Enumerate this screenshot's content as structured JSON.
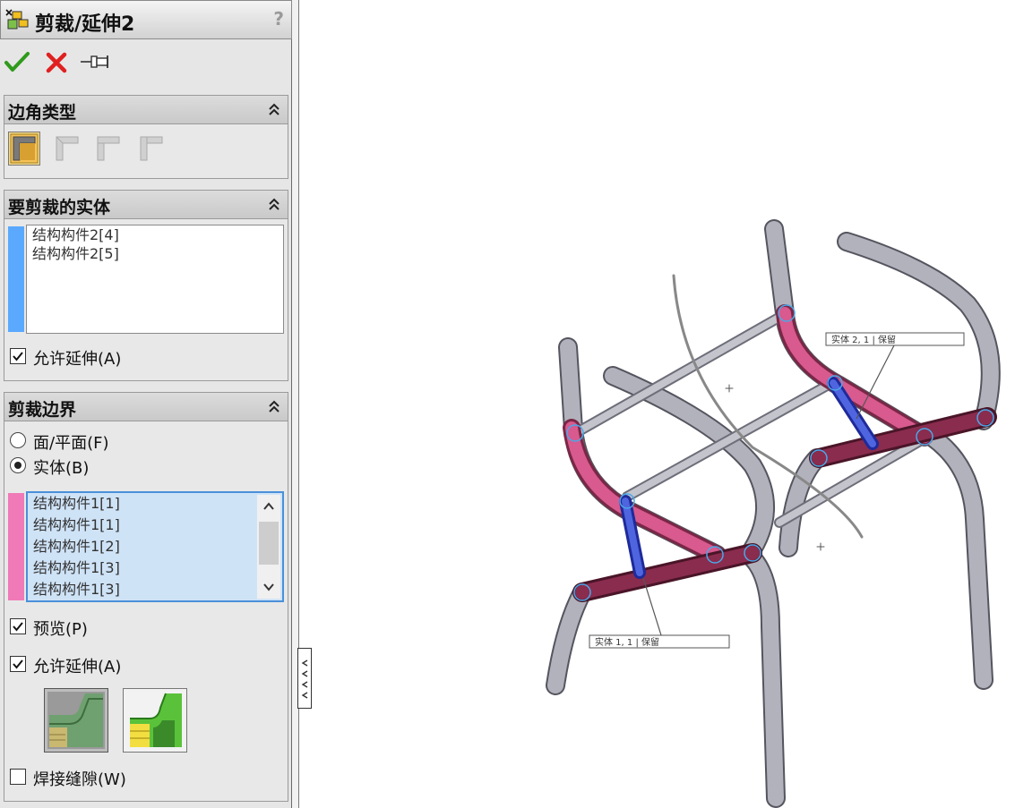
{
  "panel": {
    "title": "剪裁/延伸2",
    "help": "?",
    "sections": {
      "corner_type": {
        "title": "边角类型"
      },
      "bodies_to_trim": {
        "title": "要剪裁的实体",
        "items": [
          "结构构件2[4]",
          "结构构件2[5]"
        ],
        "allow_extension": "允许延伸(A)"
      },
      "trim_boundary": {
        "title": "剪裁边界",
        "radio_face": "面/平面(F)",
        "radio_body": "实体(B)",
        "items": [
          "结构构件1[1]",
          "结构构件1[1]",
          "结构构件1[2]",
          "结构构件1[3]",
          "结构构件1[3]"
        ],
        "preview": "预览(P)",
        "allow_extension": "允许延伸(A)",
        "weld_gap": "焊接缝隙(W)"
      }
    }
  },
  "viewport": {
    "callout_upper": "实体 2, 1 | 保留",
    "callout_lower": "实体 1, 1 | 保留"
  },
  "colors": {
    "panel_bg": "#e6e6e6",
    "trim_stripe": "#5aa9ff",
    "boundary_stripe": "#f07ab8",
    "selection_bg": "#cfe3f7",
    "tube": "#a8a8b4",
    "tube_trim": "#c8417a",
    "tube_boundary": "#7a2342",
    "tube_selected": "#3a4fd0"
  }
}
